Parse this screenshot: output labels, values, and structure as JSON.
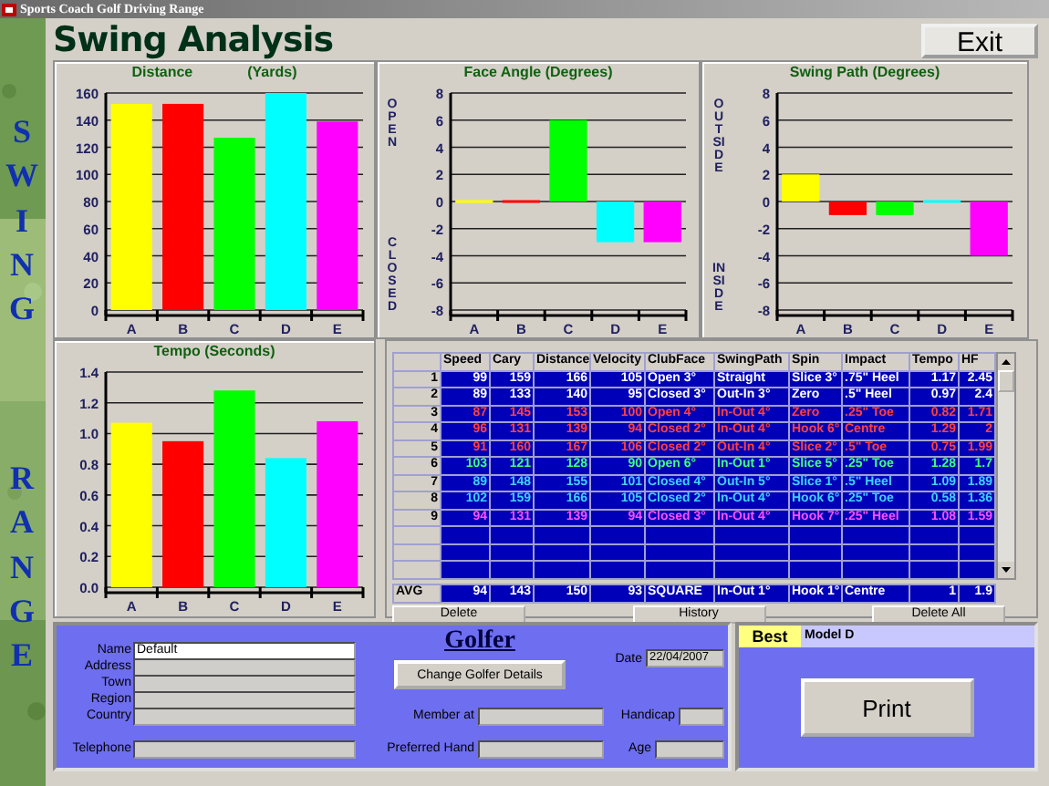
{
  "window": {
    "title": "Sports Coach Golf Driving Range"
  },
  "side_words": [
    "SWING",
    "RANGE"
  ],
  "heading": "Swing Analysis",
  "exit_button": "Exit",
  "charts": [
    {
      "title": "Distance",
      "unit": "(Yards)",
      "chart_data": {
        "type": "bar",
        "grid": true,
        "categories": [
          "A",
          "B",
          "C",
          "D",
          "E"
        ],
        "series": [
          {
            "color": "#ffff00",
            "values": [
              152,
              null,
              null,
              null,
              null
            ]
          },
          {
            "color": "#ff0000",
            "values": [
              null,
              152,
              null,
              null,
              null
            ]
          },
          {
            "color": "#00ff00",
            "values": [
              null,
              null,
              127,
              null,
              null
            ]
          },
          {
            "color": "#00ffff",
            "values": [
              null,
              null,
              null,
              160,
              null
            ]
          },
          {
            "color": "#ff00ff",
            "values": [
              null,
              null,
              null,
              null,
              139
            ]
          }
        ],
        "ylim": [
          0,
          160
        ],
        "yticks": [
          0,
          20,
          40,
          60,
          80,
          100,
          120,
          140,
          160
        ]
      }
    },
    {
      "title": "Face Angle (Degrees)",
      "side_labels": [
        "OPEN",
        "CLOSED"
      ],
      "chart_data": {
        "type": "bar",
        "grid": true,
        "categories": [
          "A",
          "B",
          "C",
          "D",
          "E"
        ],
        "series": [
          {
            "color": "#ffff00",
            "values": [
              0,
              null,
              null,
              null,
              null
            ]
          },
          {
            "color": "#ff0000",
            "values": [
              null,
              0,
              null,
              null,
              null
            ]
          },
          {
            "color": "#00ff00",
            "values": [
              null,
              null,
              6,
              null,
              null
            ]
          },
          {
            "color": "#00ffff",
            "values": [
              null,
              null,
              null,
              -3,
              null
            ]
          },
          {
            "color": "#ff00ff",
            "values": [
              null,
              null,
              null,
              null,
              -3
            ]
          }
        ],
        "ylim": [
          -8,
          8
        ],
        "yticks": [
          -8,
          -6,
          -4,
          -2,
          0,
          2,
          4,
          6,
          8
        ]
      }
    },
    {
      "title": "Swing Path (Degrees)",
      "side_labels": [
        "OUTSIDE",
        "INSIDE"
      ],
      "chart_data": {
        "type": "bar",
        "grid": true,
        "categories": [
          "A",
          "B",
          "C",
          "D",
          "E"
        ],
        "series": [
          {
            "color": "#ffff00",
            "values": [
              2,
              null,
              null,
              null,
              null
            ]
          },
          {
            "color": "#ff0000",
            "values": [
              null,
              -1,
              null,
              null,
              null
            ]
          },
          {
            "color": "#00ff00",
            "values": [
              null,
              null,
              -1,
              null,
              null
            ]
          },
          {
            "color": "#00ffff",
            "values": [
              null,
              null,
              null,
              0,
              null
            ]
          },
          {
            "color": "#ff00ff",
            "values": [
              null,
              null,
              null,
              null,
              -4
            ]
          }
        ],
        "ylim": [
          -8,
          8
        ],
        "yticks": [
          -8,
          -6,
          -4,
          -2,
          0,
          2,
          4,
          6,
          8
        ]
      }
    },
    {
      "title": "Tempo (Seconds)",
      "chart_data": {
        "type": "bar",
        "grid": true,
        "categories": [
          "A",
          "B",
          "C",
          "D",
          "E"
        ],
        "series": [
          {
            "color": "#ffff00",
            "values": [
              1.07,
              null,
              null,
              null,
              null
            ]
          },
          {
            "color": "#ff0000",
            "values": [
              null,
              0.95,
              null,
              null,
              null
            ]
          },
          {
            "color": "#00ff00",
            "values": [
              null,
              null,
              1.28,
              null,
              null
            ]
          },
          {
            "color": "#00ffff",
            "values": [
              null,
              null,
              null,
              0.84,
              null
            ]
          },
          {
            "color": "#ff00ff",
            "values": [
              null,
              null,
              null,
              null,
              1.08
            ]
          }
        ],
        "ylim": [
          0,
          1.4
        ],
        "yticks": [
          {
            "value": 0,
            "label": "0.0"
          },
          {
            "value": 0.2,
            "label": "0.2"
          },
          {
            "value": 0.4,
            "label": "0.4"
          },
          {
            "value": 0.6,
            "label": "0.6"
          },
          {
            "value": 0.8,
            "label": "0.8"
          },
          {
            "value": 1,
            "label": "1.0"
          },
          {
            "value": 1.2,
            "label": "1.2"
          },
          {
            "value": 1.4,
            "label": "1.4"
          }
        ]
      }
    }
  ],
  "shots_table": {
    "columns": [
      "Speed",
      "Cary",
      "Distance",
      "Velocity",
      "ClubFace",
      "SwingPath",
      "Spin",
      "Impact",
      "Tempo",
      "HF"
    ],
    "rows": [
      {
        "num": "1",
        "color": "#ffffff",
        "cells": [
          "99",
          "159",
          "166",
          "105",
          "Open 3°",
          "Straight",
          "Slice 3°",
          ".75\" Heel",
          "1.17",
          "2.45"
        ]
      },
      {
        "num": "2",
        "color": "#ffffff",
        "cells": [
          "89",
          "133",
          "140",
          "95",
          "Closed 3°",
          "Out-In 3°",
          "Zero",
          ".5\" Heel",
          "0.97",
          "2.4"
        ]
      },
      {
        "num": "3",
        "color": "#ff4040",
        "cells": [
          "87",
          "145",
          "153",
          "100",
          "Open 4°",
          "In-Out 4°",
          "Zero",
          ".25\" Toe",
          "0.82",
          "1.71"
        ]
      },
      {
        "num": "4",
        "color": "#ff4040",
        "cells": [
          "96",
          "131",
          "139",
          "94",
          "Closed 2°",
          "In-Out 4°",
          "Hook 6°",
          "Centre",
          "1.29",
          "2"
        ]
      },
      {
        "num": "5",
        "color": "#ff4040",
        "cells": [
          "91",
          "160",
          "167",
          "106",
          "Closed 2°",
          "Out-In 4°",
          "Slice 2°",
          ".5\" Toe",
          "0.75",
          "1.99"
        ]
      },
      {
        "num": "6",
        "color": "#40ff80",
        "cells": [
          "103",
          "121",
          "128",
          "90",
          "Open 6°",
          "In-Out 1°",
          "Slice 5°",
          ".25\" Toe",
          "1.28",
          "1.7"
        ]
      },
      {
        "num": "7",
        "color": "#40d0ff",
        "cells": [
          "89",
          "148",
          "155",
          "101",
          "Closed 4°",
          "Out-In 5°",
          "Slice 1°",
          ".5\" Heel",
          "1.09",
          "1.89"
        ]
      },
      {
        "num": "8",
        "color": "#40d0ff",
        "cells": [
          "102",
          "159",
          "166",
          "105",
          "Closed 2°",
          "In-Out 4°",
          "Hook 6°",
          ".25\" Toe",
          "0.58",
          "1.36"
        ]
      },
      {
        "num": "9",
        "color": "#ff50ff",
        "cells": [
          "94",
          "131",
          "139",
          "94",
          "Closed 3°",
          "In-Out 4°",
          "Hook 7°",
          ".25\" Heel",
          "1.08",
          "1.59"
        ]
      }
    ],
    "average": {
      "label": "AVG",
      "cells": [
        "94",
        "143",
        "150",
        "93",
        "SQUARE",
        "In-Out 1°",
        "Hook 1°",
        "Centre",
        "1",
        "1.9"
      ]
    },
    "buttons": [
      "Delete",
      "History",
      "Delete All"
    ]
  },
  "golfer": {
    "title": "Golfer",
    "fields": [
      {
        "label": "Name",
        "value": "Default",
        "disabled": false
      },
      {
        "label": "Address",
        "disabled": true
      },
      {
        "label": "Town",
        "disabled": true
      },
      {
        "label": "Region",
        "disabled": true
      },
      {
        "label": "Country",
        "disabled": true
      },
      {
        "label": "Telephone",
        "disabled": true
      }
    ],
    "change_button": "Change Golfer Details",
    "date": {
      "label": "Date",
      "value": "22/04/2007"
    },
    "member_at": {
      "label": "Member at"
    },
    "preferred_hand": {
      "label": "Preferred Hand"
    },
    "handicap": {
      "label": "Handicap"
    },
    "age": {
      "label": "Age"
    }
  },
  "best": {
    "label": "Best",
    "value": "Model D"
  },
  "print_button": "Print"
}
